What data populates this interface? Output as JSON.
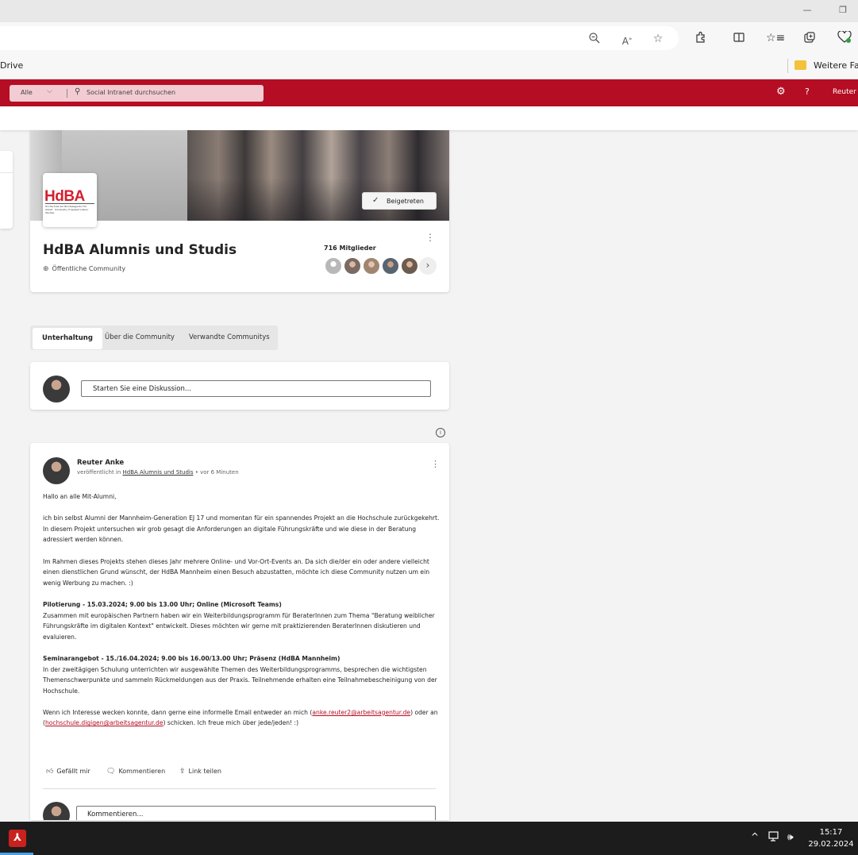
{
  "browser": {
    "window_minimize": "—",
    "window_restore": "❐",
    "favorites_left": "Drive",
    "favorites_folder": "Weitere Favoriten"
  },
  "suitebar": {
    "scope": "Alle",
    "search_placeholder": "Social Intranet durchsuchen",
    "user": "Reuter"
  },
  "community": {
    "logo_text": "HdBA",
    "logo_subtext": "Hochschule der Bundesagentur für Arbeit · University of Applied Labour Studies",
    "joined_label": "Beigetreten",
    "title": "HdBA Alumnis und Studis",
    "type": "Öffentliche Community",
    "members": "716 Mitglieder"
  },
  "tabs": [
    {
      "label": "Unterhaltung"
    },
    {
      "label": "Über die Community"
    },
    {
      "label": "Verwandte Communitys"
    }
  ],
  "compose": {
    "placeholder": "Starten Sie eine Diskussion..."
  },
  "post": {
    "author": "Reuter Anke",
    "published_in": "veröffentlicht in",
    "community_link": "HdBA Alumnis und Studis",
    "time": "• vor 6 Minuten",
    "greeting": "Hallo an alle Mit-Alumni,",
    "p1": "ich bin selbst Alumni der Mannheim-Generation EJ 17 und momentan für ein spannendes Projekt an die Hochschule zurückgekehrt. In diesem Projekt untersuchen wir grob gesagt die Anforderungen an digitale Führungskräfte und wie diese in der Beratung adressiert werden können.",
    "p2": "Im Rahmen dieses Projekts stehen dieses Jahr mehrere Online- und Vor-Ort-Events an. Da sich die/der ein oder andere vielleicht einen dienstlichen Grund wünscht, der HdBA Mannheim einen Besuch abzustatten, möchte ich diese Community nutzen um ein wenig Werbung zu machen. :)",
    "h1": "Pilotierung - 15.03.2024; 9.00 bis 13.00 Uhr; Online (Microsoft Teams)",
    "p3": "Zusammen mit europäischen Partnern haben wir ein Weiterbildungsprogramm für BeraterInnen zum Thema \"Beratung weiblicher Führungskräfte im digitalen Kontext\" entwickelt. Dieses möchten wir gerne mit praktizierenden BeraterInnen diskutieren und evaluieren.",
    "h2": "Seminarangebot - 15./16.04.2024; 9.00 bis 16.00/13.00 Uhr; Präsenz (HdBA Mannheim)",
    "p4": "In der zweitägigen Schulung unterrichten wir ausgewählte Themen des Weiterbildungsprogramms, besprechen die wichtigsten Themenschwerpunkte und sammeln Rückmeldungen aus der Praxis. Teilnehmende erhalten eine Teilnahmebescheinigung von der Hochschule.",
    "p5_a": "Wenn ich Interesse wecken konnte, dann gerne eine informelle Email entweder an mich (",
    "email1": "anke.reuter2@arbeitsagentur.de",
    "p5_b": ") oder an (",
    "email2": "hochschule.digigen@arbeitsagentur.de",
    "p5_c": ") schicken. Ich freue mich über jede/jeden! :)",
    "like": "Gefällt mir",
    "comment": "Kommentieren",
    "share": "Link teilen",
    "comment_placeholder": "Kommentieren..."
  },
  "taskbar": {
    "time": "15:17",
    "date": "29.02.2024"
  },
  "colors": {
    "brand_red": "#b50d23",
    "link": "#b50d23"
  }
}
